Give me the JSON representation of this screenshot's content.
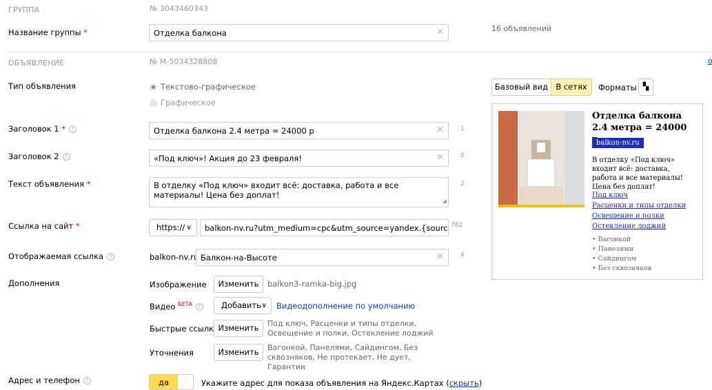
{
  "group": {
    "section": "ГРУППА",
    "number": "№ 3043460343",
    "name_label": "Название группы",
    "name_value": "Отделка балкона",
    "ads_count": "16 объявлений"
  },
  "ad": {
    "section": "ОБЪЯВЛЕНИЕ",
    "number": "№ M-5034328808",
    "type_label": "Тип объявления",
    "type_options": [
      "Текстово-графическое",
      "Графическое"
    ],
    "title1_label": "Заголовок 1",
    "title1_value": "Отделка балкона 2.4 метра = 24000 р",
    "title1_count": "1",
    "title2_label": "Заголовок 2",
    "title2_value": "«Под ключ»! Акция до 23 февраля!",
    "title2_count": "0",
    "text_label": "Текст объявления",
    "text_value": "В отделку «Под ключ» входит всё: доставка, работа и все материалы! Цена без доплат!",
    "text_count": "2",
    "link_label": "Ссылка на сайт",
    "protocol": "https://",
    "link_value": "balkon-nv.ru?utm_medium=cpc&utm_source=yandex.{source_type}&",
    "link_count": "782",
    "display_label": "Отображаемая ссылка",
    "display_prefix": "balkon-nv.ru/",
    "display_value": "Балкон-на-Высоте",
    "display_count": "4",
    "extras_label": "Дополнения",
    "image_label": "Изображение",
    "image_button": "Изменить",
    "image_file": "balkon3-ramka-big.jpg",
    "video_label": "Видео",
    "video_badge": "БЕТА",
    "video_button": "Добавить",
    "video_link": "Видеодополнение по умолчанию",
    "quick_label": "Быстрые ссылки",
    "quick_button": "Изменить",
    "quick_text": "Под ключ, Расценки и типы отделки, Освещение и полки, Остекление лоджий",
    "clar_label": "Уточнения",
    "clar_button": "Изменить",
    "clar_text": "Вагонкой, Панелями, Сайдингом, Без сквозняков, Не протекает, Не дует, Гарантии",
    "address_label": "Адрес и телефон",
    "address_toggle": "да",
    "address_hint": "Укажите адрес для показа объявления на Яндекс.Картах (",
    "address_link": "скрыть",
    "address_hint_end": ")"
  },
  "preview": {
    "tabs": [
      "Базовый вид",
      "В сетях",
      "Форматы"
    ],
    "title": "Отделка балкона 2.4 метра = 24000 р",
    "domain": "balkon-nv.ru",
    "text": "В отделку «Под ключ» входит всё: доставка, работа и все материалы! Цена без доплат!",
    "links": [
      "Под ключ",
      "Расценки и типы отделки",
      "Освещение и полки",
      "Остекление лоджий"
    ],
    "clarifications": [
      "• Вагонкой",
      "• Панелями",
      "• Сайдингом",
      "• Без сквозняков"
    ]
  },
  "edge_link": "о",
  "colors": {
    "accent_tab": "#fff0b3",
    "toggle_on": "#ffdb4d",
    "domain_bg": "#1d2db4",
    "link": "#1a2aa8"
  }
}
